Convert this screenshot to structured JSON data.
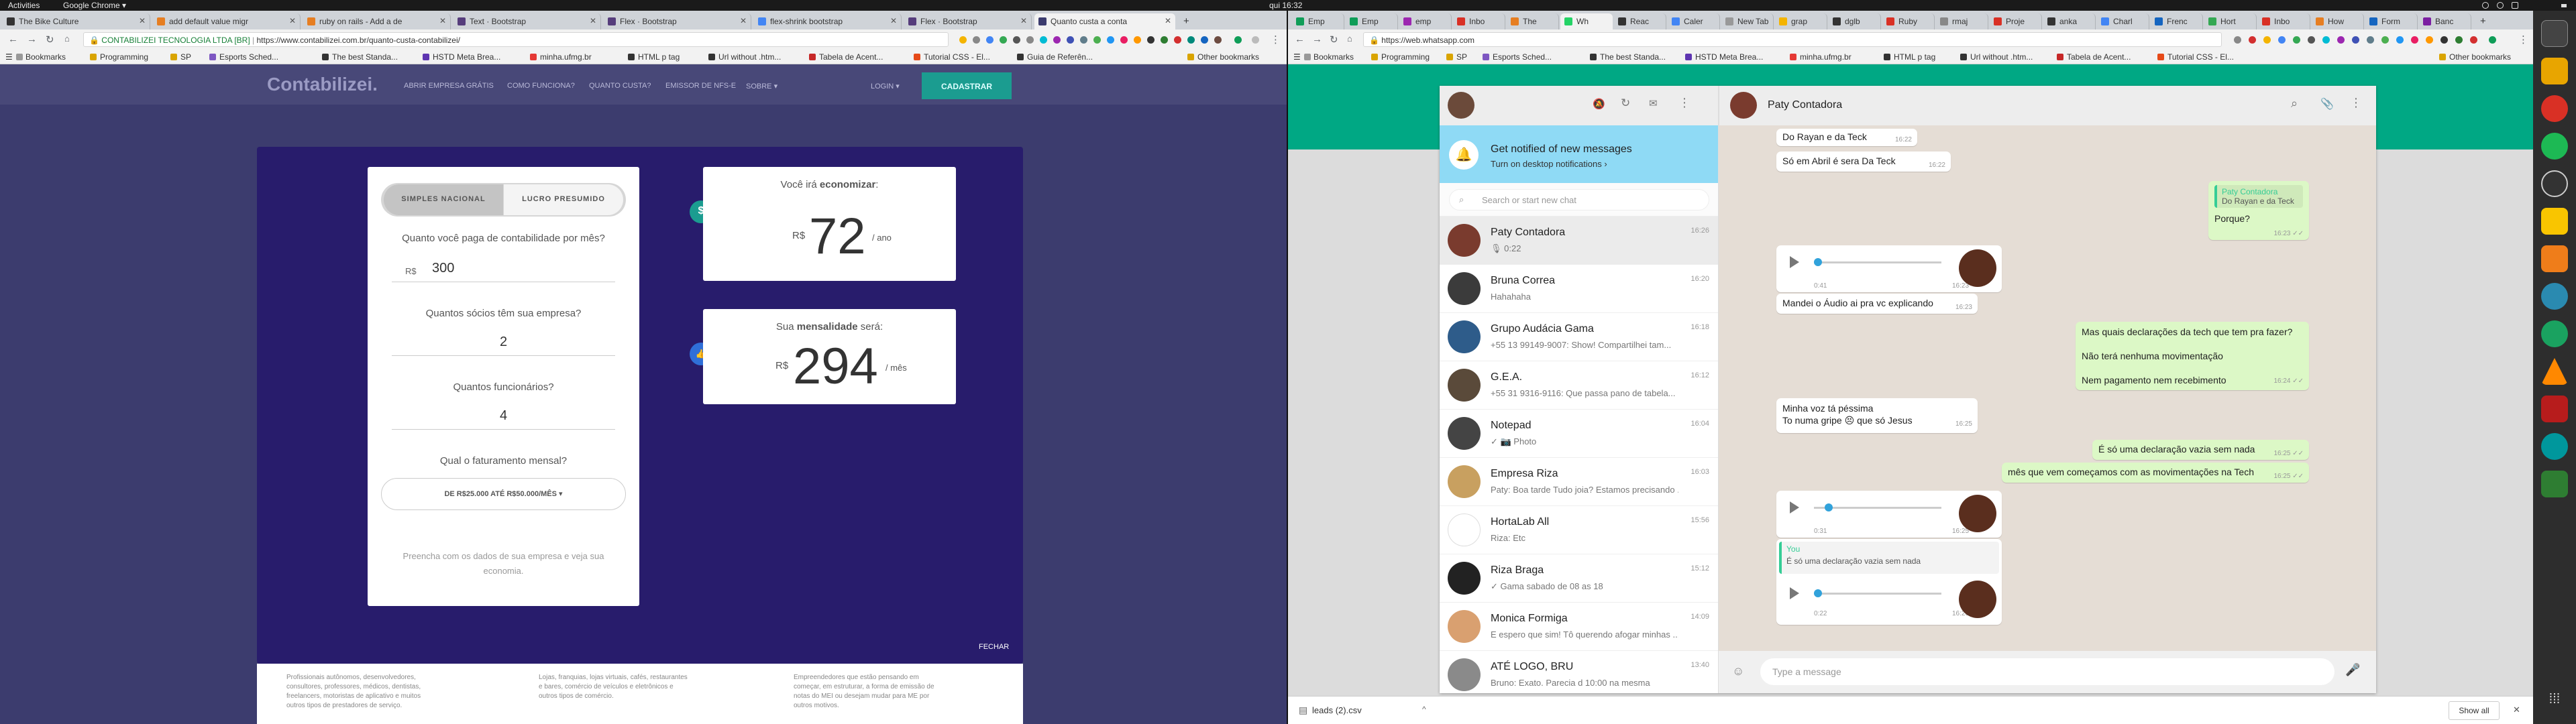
{
  "topbar": {
    "activities": "Activities",
    "app_menu": "Google Chrome ▾",
    "clock": "qui 16:32"
  },
  "left_browser": {
    "tabs": [
      {
        "label": "The Bike Culture",
        "color": "#333"
      },
      {
        "label": "add default value migr",
        "color": "#e67e22"
      },
      {
        "label": "ruby on rails - Add a de",
        "color": "#e67e22"
      },
      {
        "label": "Text · Bootstrap",
        "color": "#563d7c"
      },
      {
        "label": "Flex · Bootstrap",
        "color": "#563d7c"
      },
      {
        "label": "flex-shrink bootstrap",
        "color": "#4285f4"
      },
      {
        "label": "Flex · Bootstrap",
        "color": "#563d7c"
      },
      {
        "label": "Quanto custa a conta",
        "color": "#3c3c6e"
      }
    ],
    "site_info": "CONTABILIZEI TECNOLOGIA LTDA [BR]",
    "url": "https://www.contabilizei.com.br/quanto-custa-contabilizei/",
    "bookmarks": [
      "Bookmarks",
      "Programming",
      "SP",
      "Esports Sched...",
      "The best Standa...",
      "HSTD Meta Brea...",
      "minha.ufmg.br",
      "HTML p tag",
      "Url without .htm...",
      "Tabela de Acent...",
      "Tutorial CSS - El...",
      "Guia de Referên...",
      "Other bookmarks"
    ]
  },
  "contabilizei": {
    "logo": "Contabilizei.",
    "nav": [
      "ABRIR EMPRESA GRÁTIS",
      "COMO FUNCIONA?",
      "QUANTO CUSTA?",
      "EMISSOR DE NFS-E",
      "SOBRE ▾"
    ],
    "login": "LOGIN ▾",
    "signup": "CADASTRAR",
    "seg_simples": "SIMPLES NACIONAL",
    "seg_lucro": "LUCRO PRESUMIDO",
    "q1": "Quanto você paga de contabilidade por mês?",
    "currency": "R$",
    "a1": "300",
    "q2": "Quantos sócios têm sua empresa?",
    "a2": "2",
    "q3": "Quantos funcionários?",
    "a3": "4",
    "q4": "Qual o faturamento mensal?",
    "revenue_select": "DE R$25.000 ATÉ R$50.000/MÊS ▾",
    "footnote": "Preencha com os dados de sua empresa e veja sua economia.",
    "save_pre": "Você irá",
    "save_bold": "economizar",
    "save_post": ":",
    "save_currency": "R$",
    "save_value": "72",
    "save_unit": "/ ano",
    "fee_pre": "Sua",
    "fee_bold": "mensalidade",
    "fee_post": "será:",
    "fee_currency": "R$",
    "fee_value": "294",
    "fee_unit": "/ mês",
    "close": "FECHAR",
    "below": [
      "Profissionais autônomos, desenvolvedores, consultores, professores, médicos, dentistas, freelancers, motoristas de aplicativo e muitos outros tipos de prestadores de serviço.",
      "Lojas, franquias, lojas virtuais, cafés, restaurantes e bares, comércio de veículos e eletrônicos e outros tipos de comércio.",
      "Empreendedores que estão pensando em começar, em estruturar, a forma de emissão de notas do MEI ou desejam mudar para ME por outros motivos."
    ]
  },
  "right_browser": {
    "tabs": [
      "Emp",
      "Emp",
      "emp",
      "Inbo",
      "The",
      "Wh",
      "Reac",
      "Caler",
      "New Tab",
      "grap",
      "dglb",
      "Ruby",
      "rmaj",
      "Proje",
      "anka",
      "Charl",
      "Frenc",
      "Hort",
      "Inbo",
      "How",
      "Form",
      "Banc"
    ],
    "url": "https://web.whatsapp.com",
    "bookmarks": [
      "Bookmarks",
      "Programming",
      "SP",
      "Esports Sched...",
      "The best Standa...",
      "HSTD Meta Brea...",
      "minha.ufmg.br",
      "HTML p tag",
      "Url without .htm...",
      "Tabela de Acent...",
      "Tutorial CSS - El...",
      "Other bookmarks"
    ]
  },
  "whatsapp": {
    "notify_title": "Get notified of new messages",
    "notify_sub": "Turn on desktop notifications ›",
    "search_placeholder": "Search or start new chat",
    "chats": [
      {
        "name": "Paty Contadora",
        "preview": "🎙 0:22",
        "time": "16:26",
        "color": "#7a3b2e"
      },
      {
        "name": "Bruna Correa",
        "preview": "Hahahaha",
        "time": "16:20",
        "color": "#3b3b3b"
      },
      {
        "name": "Grupo Audácia Gama",
        "preview": "+55 13 99149-9007: Show! Compartilhei tam...",
        "time": "16:18",
        "color": "#2e5c8a"
      },
      {
        "name": "G.E.A.",
        "preview": "+55 31 9316-9116: Que passa pano de tabela...",
        "time": "16:12",
        "color": "#5a4a3a"
      },
      {
        "name": "Notepad",
        "preview": "✓ 📷 Photo",
        "time": "16:04",
        "color": "#444"
      },
      {
        "name": "Empresa Riza",
        "preview": "Paty: Boa tarde Tudo joia? Estamos precisando ...",
        "time": "16:03",
        "color": "#c8a060"
      },
      {
        "name": "HortaLab All",
        "preview": "Riza: Etc",
        "time": "15:56",
        "color": "#ffffff"
      },
      {
        "name": "Riza Braga",
        "preview": "✓ Gama sabado de 08 as 18",
        "time": "15:12",
        "color": "#222"
      },
      {
        "name": "Monica Formiga",
        "preview": "E espero que sim! Tô querendo afogar minhas ...",
        "time": "14:09",
        "color": "#d9a070"
      },
      {
        "name": "ATÉ LOGO, BRU",
        "preview": "Bruno: Exato. Parecia d 10:00 na mesma",
        "time": "13:40",
        "color": "#8a8a8a"
      }
    ],
    "contact": "Paty Contadora",
    "messages": {
      "m1": "Do Rayan e da Teck",
      "m1t": "16:22",
      "m2": "Só em Abril é sera Da Teck",
      "m2t": "16:22",
      "quote_author": "Paty Contadora",
      "quote_text": "Do Rayan e da Teck",
      "m3": "Porque?",
      "m3t": "16:23 ✓✓",
      "audio1_dur": "0:41",
      "audio1_t": "16:23",
      "m4": "Mandei o Áudio ai pra vc explicando",
      "m4t": "16:23",
      "m5a": "Mas quais declarações da tech que tem pra fazer?",
      "m5b": "Não terá nenhuma movimentação",
      "m5c": "Nem pagamento nem recebimento",
      "m5t": "16:24 ✓✓",
      "m6a": "Minha voz tá péssima",
      "m6b": "To numa gripe 😣 que só Jesus",
      "m6t": "16:25",
      "m7": "É só uma declaração vazia sem nada",
      "m7t": "16:25 ✓✓",
      "m8": "mês que vem começamos com as movimentações na Tech",
      "m8t": "16:25 ✓✓",
      "audio2_dur": "0:31",
      "audio2_t": "16:25",
      "reply_author": "You",
      "reply_text": "É só uma declaração vazia sem nada",
      "audio3_dur": "0:22",
      "audio3_t": "16:26"
    },
    "composer_placeholder": "Type a message"
  },
  "download": {
    "file": "leads (2).csv",
    "show_all": "Show all"
  }
}
